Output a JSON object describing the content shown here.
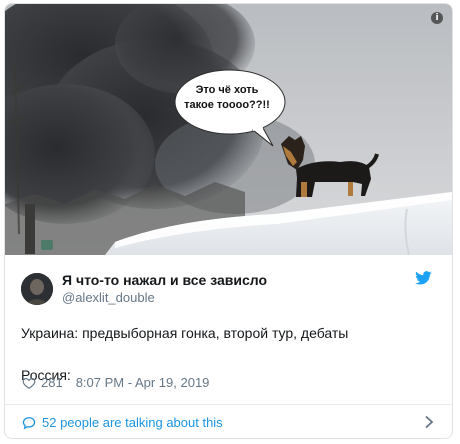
{
  "media": {
    "bubble_line1": "Это чё хоть",
    "bubble_line2": "такое тоооо??!!",
    "info_icon": "info-icon"
  },
  "user": {
    "display_name": "Я что-то нажал и все зависло",
    "handle": "@alexlit_double"
  },
  "tweet": {
    "line1": "Украина: предвыборная гонка, второй тур, дебаты",
    "line2": "Россия:"
  },
  "meta": {
    "like_count": "281",
    "timestamp": "8:07 PM - Apr 19, 2019"
  },
  "footer": {
    "label": "52 people are talking about this"
  },
  "colors": {
    "brand": "#1da1f2",
    "link": "#1b95e0",
    "secondary_text": "#657786",
    "primary_text": "#14171a"
  }
}
